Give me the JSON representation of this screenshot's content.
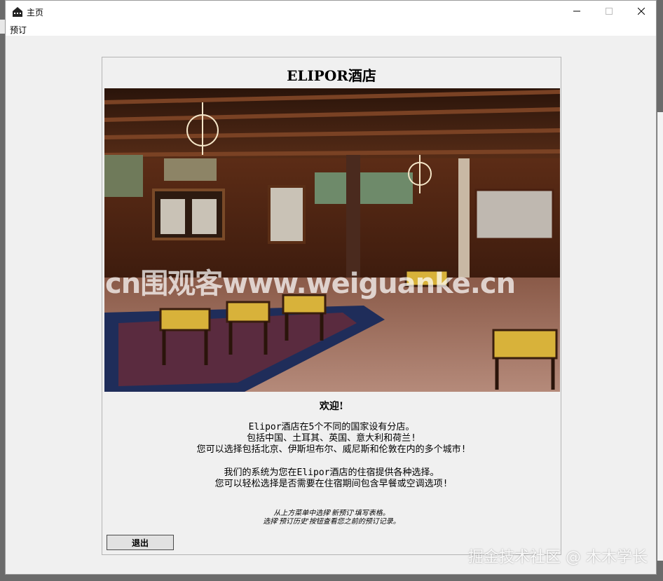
{
  "window": {
    "title": "主页",
    "icons": {
      "app": "hotel-app-icon",
      "minimize": "minimize-icon",
      "maximize": "maximize-icon",
      "close": "close-icon"
    }
  },
  "menu": {
    "items": [
      {
        "label": "预订"
      }
    ]
  },
  "hotel": {
    "title": "ELIPOR酒店",
    "image": "hotel-lobby-photo"
  },
  "content": {
    "welcome": "欢迎!",
    "paragraph1": [
      "Elipor酒店在5个不同的国家设有分店。",
      "包括中国、土耳其、英国、意大利和荷兰!",
      "您可以选择包括北京、伊斯坦布尔、威尼斯和伦敦在内的多个城市!"
    ],
    "paragraph2": [
      "我们的系统为您在Elipor酒店的住宿提供各种选择。",
      "您可以轻松选择是否需要在住宿期间包含早餐或空调选项!"
    ],
    "hint": [
      "从上方菜单中选择'新预订'填写表格。",
      "选择'预订历史'按钮查看您之前的预订记录。"
    ]
  },
  "buttons": {
    "exit": "退出"
  },
  "watermarks": {
    "center": "cn围观客www.weiguanke.cn",
    "corner": "掘金技术社区 @ 木木学长"
  }
}
